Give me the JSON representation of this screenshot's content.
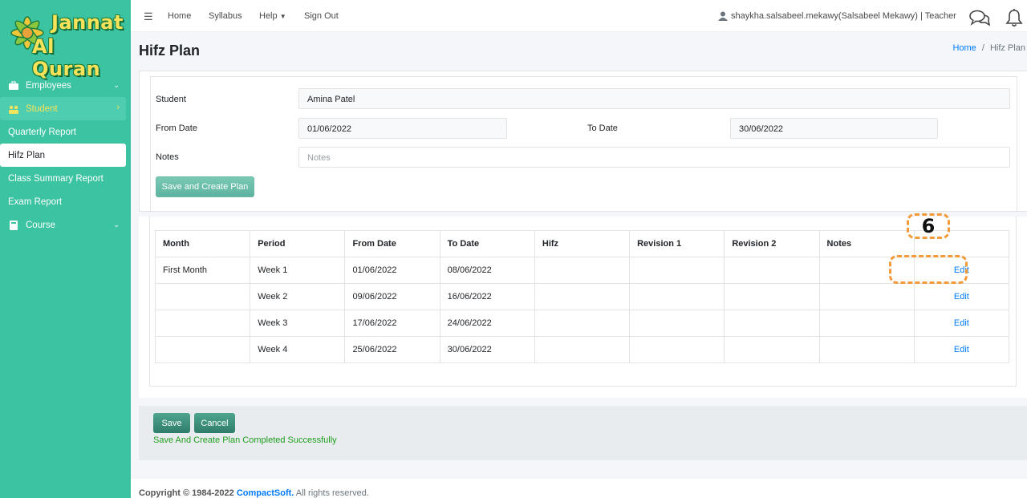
{
  "brand": {
    "line1": "Jannat",
    "line2": "Al Quran"
  },
  "sidebar": {
    "items": [
      {
        "label": "Employees"
      },
      {
        "label": "Student"
      },
      {
        "label": "Quarterly Report"
      },
      {
        "label": "Hifz Plan"
      },
      {
        "label": "Class Summary Report"
      },
      {
        "label": "Exam Report"
      },
      {
        "label": "Course"
      }
    ]
  },
  "topbar": {
    "links": [
      "Home",
      "Syllabus",
      "Help",
      "Sign Out"
    ],
    "user": "shaykha.salsabeel.mekawy(Salsabeel Mekawy) | Teacher"
  },
  "page": {
    "title": "Hifz Plan",
    "breadcrumb": {
      "home": "Home",
      "sep": "/",
      "current": "Hifz Plan"
    }
  },
  "form": {
    "student_label": "Student",
    "student_value": "Amina Patel",
    "from_label": "From Date",
    "from_value": "01/06/2022",
    "to_label": "To Date",
    "to_value": "30/06/2022",
    "notes_label": "Notes",
    "notes_placeholder": "Notes",
    "save_create_label": "Save and Create Plan"
  },
  "table": {
    "headers": [
      "Month",
      "Period",
      "From Date",
      "To Date",
      "Hifz",
      "Revision 1",
      "Revision 2",
      "Notes",
      ""
    ],
    "rows": [
      {
        "month": "First Month",
        "period": "Week 1",
        "from": "01/06/2022",
        "to": "08/06/2022",
        "action": "Edit"
      },
      {
        "month": "",
        "period": "Week 2",
        "from": "09/06/2022",
        "to": "16/06/2022",
        "action": "Edit"
      },
      {
        "month": "",
        "period": "Week 3",
        "from": "17/06/2022",
        "to": "24/06/2022",
        "action": "Edit"
      },
      {
        "month": "",
        "period": "Week 4",
        "from": "25/06/2022",
        "to": "30/06/2022",
        "action": "Edit"
      }
    ]
  },
  "annotation": {
    "step": "6",
    "color": "#f39a3a"
  },
  "actions": {
    "save_label": "Save",
    "cancel_label": "Cancel",
    "message": "Save And Create Plan Completed Successfully"
  },
  "footer": {
    "prefix": "Copyright © 1984-2022",
    "company": "CompactSoft.",
    "suffix": "All rights reserved."
  },
  "colors": {
    "sidebar": "#3cc3a2",
    "accent_link": "#007bff",
    "success": "#1e9e1e",
    "student_highlight": "#f4e35c"
  }
}
